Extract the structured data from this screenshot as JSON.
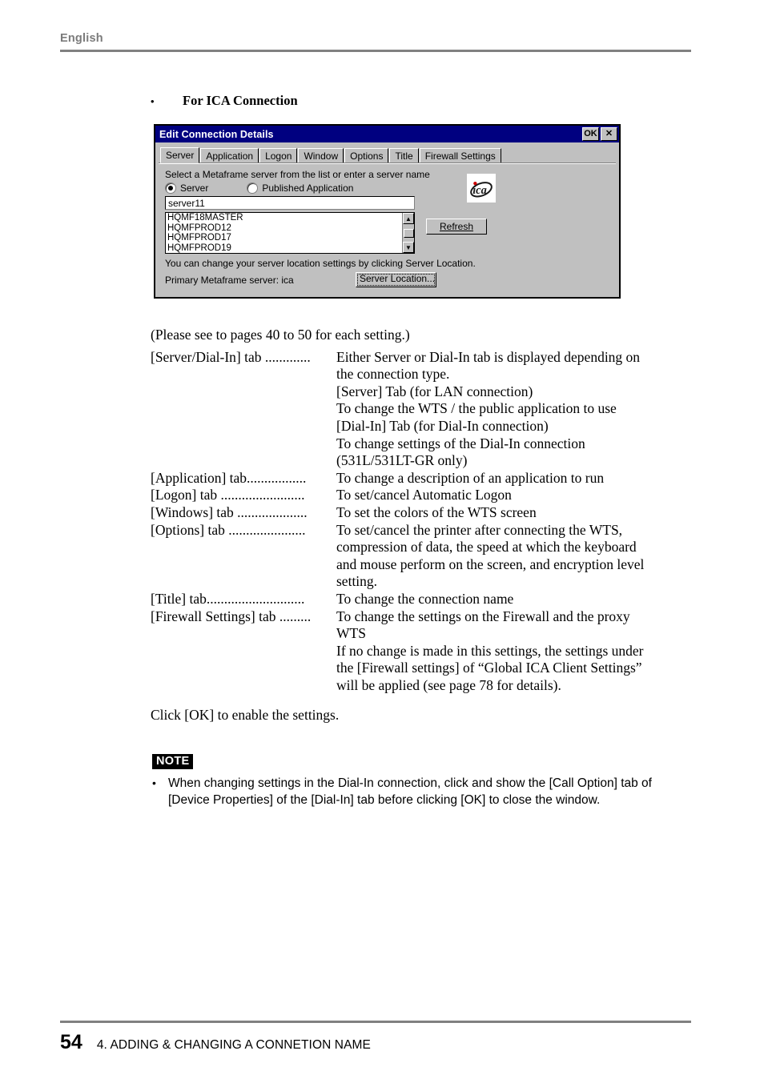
{
  "header": {
    "language_label": "English"
  },
  "section": {
    "bullet": "•",
    "heading": "For ICA Connection"
  },
  "dialog": {
    "title": "Edit Connection Details",
    "ok_label": "OK",
    "close_label": "✕",
    "tabs": [
      {
        "label": "Server",
        "selected": true
      },
      {
        "label": "Application",
        "selected": false
      },
      {
        "label": "Logon",
        "selected": false
      },
      {
        "label": "Window",
        "selected": false
      },
      {
        "label": "Options",
        "selected": false
      },
      {
        "label": "Title",
        "selected": false
      },
      {
        "label": "Firewall Settings",
        "selected": false
      }
    ],
    "hint": "Select a Metaframe server from the list or enter a server name",
    "radio_server_label": "Server",
    "radio_published_label": "Published Application",
    "radio_selected": "Server",
    "server_field_value": "server11",
    "server_list": [
      "HQMF18MASTER",
      "HQMFPROD12",
      "HQMFPROD17",
      "HQMFPROD19"
    ],
    "refresh_label": "Refresh",
    "location_note": "You can change your server location settings by clicking Server Location.",
    "primary_server_text": "Primary Metaframe server: ica",
    "server_location_label": "Server Location...",
    "logo_alt": "ica",
    "colors": {
      "titlebar": "#000080",
      "face": "#c0c0c0",
      "logo_dot": "#cc0000"
    }
  },
  "body": {
    "intro": "(Please see to pages 40 to 50 for each setting.)",
    "definitions": [
      {
        "term": "[Server/Dial-In] tab .............",
        "desc": "Either Server or Dial-In tab is displayed depending on",
        "continuation": [
          "the connection type.",
          "[Server] Tab  (for LAN connection)",
          "To change the WTS / the public application to use",
          "[Dial-In] Tab (for Dial-In connection)",
          "To change settings of the Dial-In connection",
          "(531L/531LT-GR only)"
        ]
      },
      {
        "term": "[Application] tab.................",
        "desc": "To change a description of an application to run",
        "continuation": []
      },
      {
        "term": "[Logon] tab ........................",
        "desc": "To set/cancel Automatic Logon",
        "continuation": []
      },
      {
        "term": "[Windows] tab ....................",
        "desc": "To set the colors of the WTS screen",
        "continuation": []
      },
      {
        "term": "[Options] tab ......................",
        "desc": "To set/cancel the printer after connecting the WTS,",
        "continuation": [
          "compression of data, the speed at which the keyboard",
          "and mouse perform on the screen, and encryption level",
          "setting."
        ]
      },
      {
        "term": "[Title] tab............................",
        "desc": "To change the connection name",
        "continuation": []
      },
      {
        "term": "[Firewall Settings] tab .........",
        "desc": "To change the settings on the Firewall and the proxy",
        "continuation": [
          "WTS",
          "If no change is made in this settings, the settings under",
          "the [Firewall settings] of “Global ICA Client Settings”",
          "will be applied (see page 78 for details)."
        ]
      }
    ],
    "click_ok": "Click [OK] to enable the settings."
  },
  "note": {
    "badge": "NOTE",
    "bullet": "•",
    "text": "When changing settings in the Dial-In connection, click and show the [Call Option] tab of [Device Properties] of the [Dial-In] tab before clicking [OK] to close the window."
  },
  "footer": {
    "page_number": "54",
    "chapter_title": "4. ADDING & CHANGING A CONNETION NAME"
  }
}
